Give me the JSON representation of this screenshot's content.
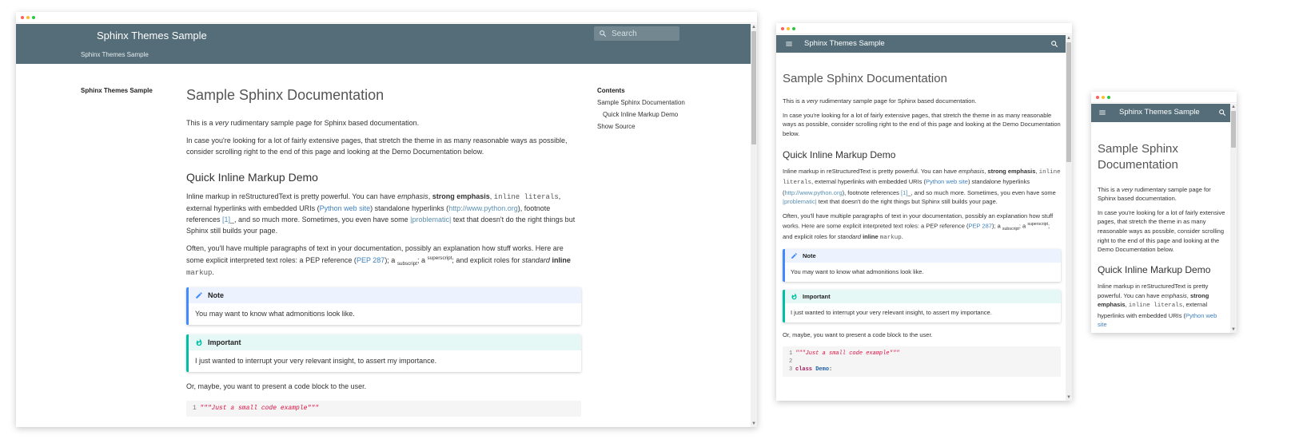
{
  "site": {
    "title": "Sphinx Themes Sample",
    "subtitle": "Sphinx Themes Sample",
    "search_placeholder": "Search"
  },
  "sidebar": {
    "title": "Sphinx Themes Sample"
  },
  "toc": {
    "heading": "Contents",
    "items": [
      "Sample Sphinx Documentation",
      "Quick Inline Markup Demo"
    ],
    "show_source": "Show Source"
  },
  "page": {
    "h1": "Sample Sphinx Documentation",
    "p1_pre": "This is a ",
    "p1_em": "very",
    "p1_post": " rudimentary sample page for Sphinx based documentation.",
    "p2": "In case you're looking for a lot of fairly extensive pages, that stretch the theme in as many reasonable ways as possible, consider scrolling right to the end of this page and looking at the Demo Documentation below.",
    "h2": "Quick Inline Markup Demo",
    "p3_a": "Inline markup in reStructuredText is pretty powerful. You can have ",
    "p3_em": "emphasis",
    "p3_comma": ", ",
    "p3_strong": "strong emphasis",
    "p3_comma2": ", ",
    "p3_code": "inline literals",
    "p3_b": ", external hyperlinks with embedded URIs (",
    "p3_link1": "Python web site",
    "p3_c": ") standalone hyperlinks (",
    "p3_link2": "http://www.python.org",
    "p3_d": "), footnote references ",
    "p3_fn": "[1]",
    "p3_e": "_, and so much more. Sometimes, you even have some ",
    "p3_problem": "|problematic|",
    "p3_f": " text that doesn't do the right things but Sphinx still builds your page.",
    "p4_a": "Often, you'll have multiple paragraphs of text in your documentation, possibly an explanation how stuff works. Here are some explicit interpreted text roles: a PEP reference (",
    "p4_pep": "PEP 287",
    "p4_b": "); a ",
    "p4_sub": "subscript",
    "p4_c": "; a ",
    "p4_sup": "superscript",
    "p4_d": "; and explicit roles for ",
    "p4_em": "standard",
    "p4_sp": " ",
    "p4_strong": "inline",
    "p4_sp2": " ",
    "p4_code": "markup",
    "p4_end": ".",
    "note_title": "Note",
    "note_body": "You may want to know what admonitions look like.",
    "imp_title": "Important",
    "imp_body": "I just wanted to interrupt your very relevant insight, to assert my importance.",
    "code_intro": "Or, maybe, you want to present a code block to the user.",
    "code_lines": [
      {
        "n": "1",
        "text": "\"\"\"Just a small code example\"\"\""
      },
      {
        "n": "2",
        "text": ""
      },
      {
        "n": "3",
        "kw": "class",
        "cls": "Demo",
        "rest": ":"
      }
    ]
  },
  "colors": {
    "header": "#546d78",
    "note_accent": "#448aff",
    "important_accent": "#00bfa5",
    "link": "#3f7fbd"
  }
}
